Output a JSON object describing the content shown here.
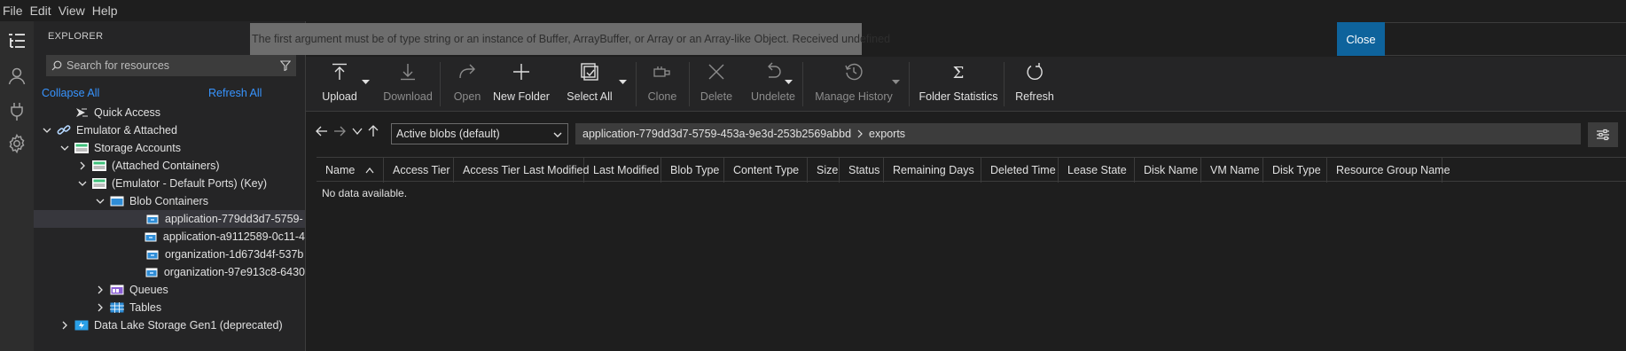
{
  "menu": [
    "File",
    "Edit",
    "View",
    "Help"
  ],
  "explorer": {
    "title": "EXPLORER",
    "search_placeholder": "Search for resources",
    "collapse_all": "Collapse All",
    "refresh_all": "Refresh All",
    "tree": [
      {
        "label": "Quick Access",
        "depth": 1,
        "chevron": "none",
        "icon": "quick-access-icon"
      },
      {
        "label": "Emulator & Attached",
        "depth": 0,
        "chevron": "down",
        "icon": "link-icon"
      },
      {
        "label": "Storage Accounts",
        "depth": 1,
        "chevron": "down",
        "icon": "storage-account-icon"
      },
      {
        "label": "(Attached Containers)",
        "depth": 2,
        "chevron": "right",
        "icon": "storage-account-icon"
      },
      {
        "label": "(Emulator - Default Ports) (Key)",
        "depth": 2,
        "chevron": "down",
        "icon": "storage-account-icon"
      },
      {
        "label": "Blob Containers",
        "depth": 3,
        "chevron": "down",
        "icon": "blob-containers-icon"
      },
      {
        "label": "application-779dd3d7-5759-",
        "depth": 5,
        "chevron": "none",
        "icon": "container-icon",
        "selected": true
      },
      {
        "label": "application-a9112589-0c11-4",
        "depth": 5,
        "chevron": "none",
        "icon": "container-icon"
      },
      {
        "label": "organization-1d673d4f-537b",
        "depth": 5,
        "chevron": "none",
        "icon": "container-icon"
      },
      {
        "label": "organization-97e913c8-6430",
        "depth": 5,
        "chevron": "none",
        "icon": "container-icon"
      },
      {
        "label": "Queues",
        "depth": 3,
        "chevron": "right",
        "icon": "queues-icon"
      },
      {
        "label": "Tables",
        "depth": 3,
        "chevron": "right",
        "icon": "tables-icon"
      },
      {
        "label": "Data Lake Storage Gen1 (deprecated)",
        "depth": 1,
        "chevron": "right",
        "icon": "data-lake-icon"
      }
    ]
  },
  "banner": {
    "message": "The first argument must be of type string or an instance of Buffer, ArrayBuffer, or Array or an Array-like Object. Received undefined",
    "close_label": "Close"
  },
  "toolbar": {
    "upload": "Upload",
    "download": "Download",
    "open": "Open",
    "new_folder": "New Folder",
    "select_all": "Select All",
    "clone": "Clone",
    "delete": "Delete",
    "undelete": "Undelete",
    "manage_history": "Manage History",
    "folder_statistics": "Folder Statistics",
    "refresh": "Refresh"
  },
  "address": {
    "view_select": "Active blobs (default)",
    "path": [
      "application-779dd3d7-5759-453a-9e3d-253b2569abbd",
      "exports"
    ]
  },
  "grid": {
    "columns": [
      "Name",
      "Access Tier",
      "Access Tier Last Modified",
      "Last Modified",
      "Blob Type",
      "Content Type",
      "Size",
      "Status",
      "Remaining Days",
      "Deleted Time",
      "Lease State",
      "Disk Name",
      "VM Name",
      "Disk Type",
      "Resource Group Name"
    ],
    "empty_message": "No data available."
  },
  "colors": {
    "accent": "#0e639c",
    "link": "#3794ff",
    "banner": "#6d6d6d"
  }
}
